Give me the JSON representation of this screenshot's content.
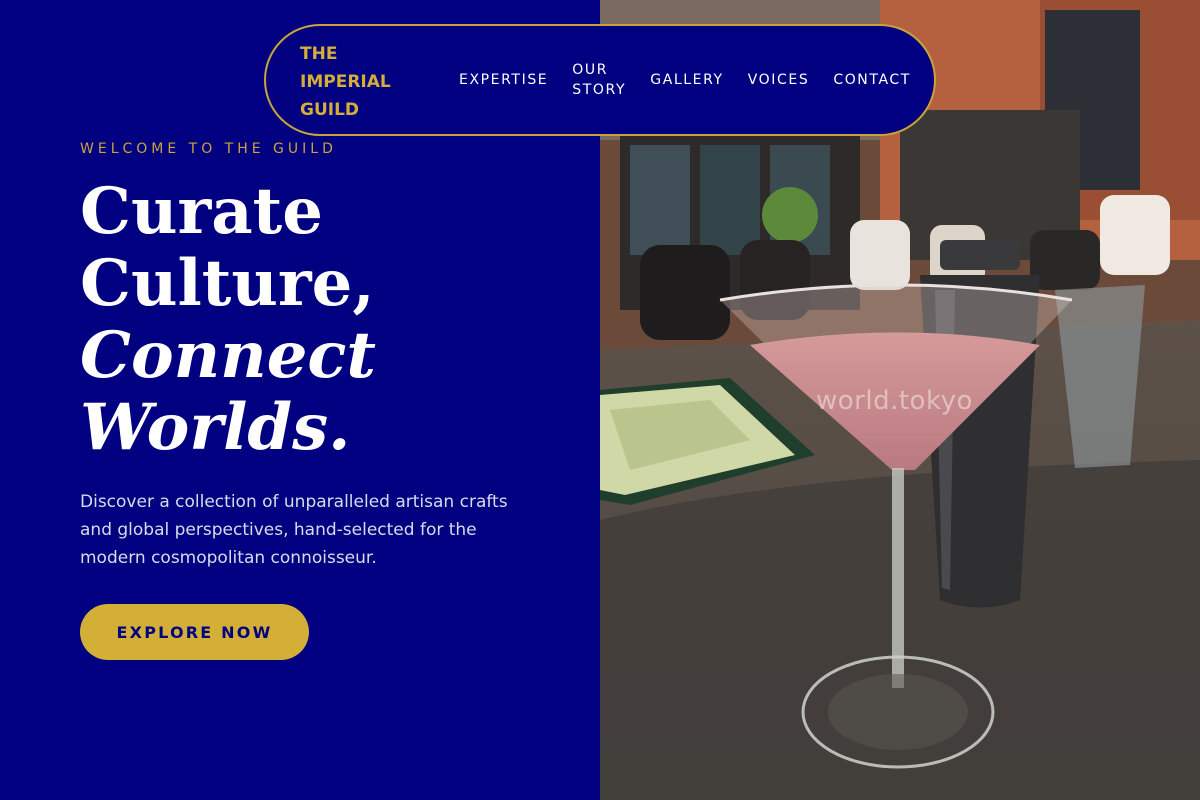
{
  "brand": {
    "name_line1": "THE",
    "name_line2": "IMPERIAL",
    "name_line3": "GUILD"
  },
  "nav": {
    "items": [
      {
        "label": "EXPERTISE"
      },
      {
        "label": "OUR STORY"
      },
      {
        "label": "GALLERY"
      },
      {
        "label": "VOICES"
      },
      {
        "label": "CONTACT"
      }
    ]
  },
  "hero": {
    "kicker": "WELCOME TO THE GUILD",
    "headline_line1": "Curate",
    "headline_line2": "Culture,",
    "headline_line3": "Connect",
    "headline_line4": "Worlds.",
    "description": "Discover a collection of unparalleled artisan crafts and global perspectives, hand-selected for the modern cosmopolitan connoisseur.",
    "cta_label": "EXPLORE NOW"
  },
  "photo": {
    "watermark": "world.tokyo"
  },
  "colors": {
    "navy": "#000080",
    "gold": "#d4af37",
    "text_light": "#d8dcea"
  }
}
